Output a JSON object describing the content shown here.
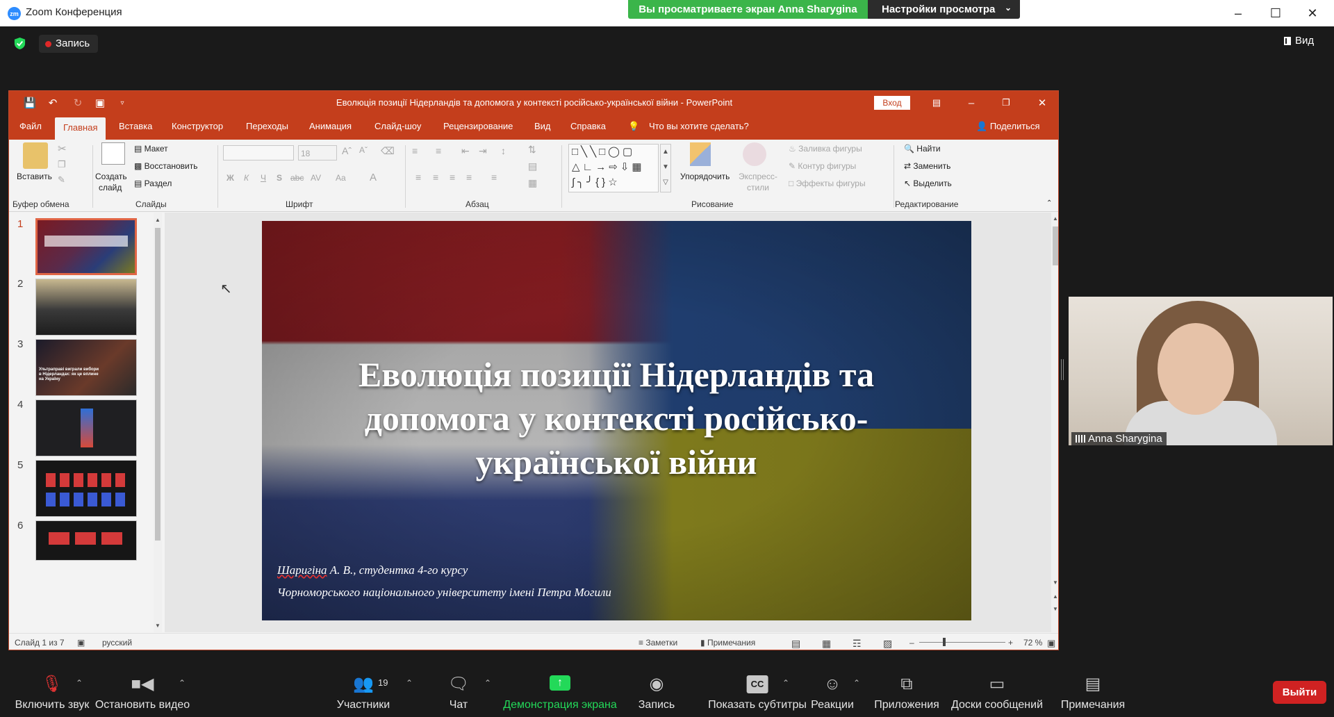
{
  "zoom": {
    "window_title": "Zoom Конференция",
    "share_banner": "Вы просматриваете экран Anna Sharygina",
    "view_options": "Настройки просмотра",
    "recording_label": "Запись",
    "view_label": "Вид"
  },
  "ppt": {
    "doc_title": "Еволюція позиції Нідерландів та допомога у контексті російсько-української війни  -  PowerPoint",
    "login": "Вход",
    "tabs": [
      "Файл",
      "Главная",
      "Вставка",
      "Конструктор",
      "Переходы",
      "Анимация",
      "Слайд-шоу",
      "Рецензирование",
      "Вид",
      "Справка",
      "Что вы хотите сделать?"
    ],
    "share": "Поделиться",
    "ribbon": {
      "paste": "Вставить",
      "clipboard_group": "Буфер обмена",
      "new_slide_1": "Создать",
      "new_slide_2": "слайд",
      "layout": "Макет",
      "reset": "Восстановить",
      "section": "Раздел",
      "slides_group": "Слайды",
      "font_size": "18",
      "font_group": "Шрифт",
      "paragraph_group": "Абзац",
      "arrange": "Упорядочить",
      "quick_styles_1": "Экспресс-",
      "quick_styles_2": "стили",
      "shape_fill": "Заливка фигуры",
      "shape_outline": "Контур фигуры",
      "shape_effects": "Эффекты фигуры",
      "drawing_group": "Рисование",
      "find": "Найти",
      "replace": "Заменить",
      "select": "Выделить",
      "editing_group": "Редактирование"
    },
    "thumb_numbers": [
      "1",
      "2",
      "3",
      "4",
      "5",
      "6"
    ],
    "thumb3_text": "Ультраправі виграли вибори в Нідерландах: як це вплине на Україну",
    "slide": {
      "title": "Еволюція позиції Нідерландів та допомога у контексті російсько-української війни",
      "author_name": "Шаригіна",
      "author_rest": " А. В., студентка 4-го курсу",
      "university": "Чорноморського національного  університету імені Петра Могили"
    },
    "status": {
      "slide_count": "Слайд 1 из 7",
      "language": "русский",
      "notes": "Заметки",
      "comments": "Примечания",
      "zoom_pct": "72 %"
    }
  },
  "participant": {
    "name": "Anna Sharygina"
  },
  "toolbar": {
    "unmute": "Включить звук",
    "stop_video": "Остановить видео",
    "participants": "Участники",
    "participants_count": "19",
    "chat": "Чат",
    "share_screen": "Демонстрация экрана",
    "record": "Запись",
    "captions": "Показать субтитры",
    "reactions": "Реакции",
    "apps": "Приложения",
    "whiteboards": "Доски сообщений",
    "notes": "Примечания",
    "leave": "Выйти"
  }
}
